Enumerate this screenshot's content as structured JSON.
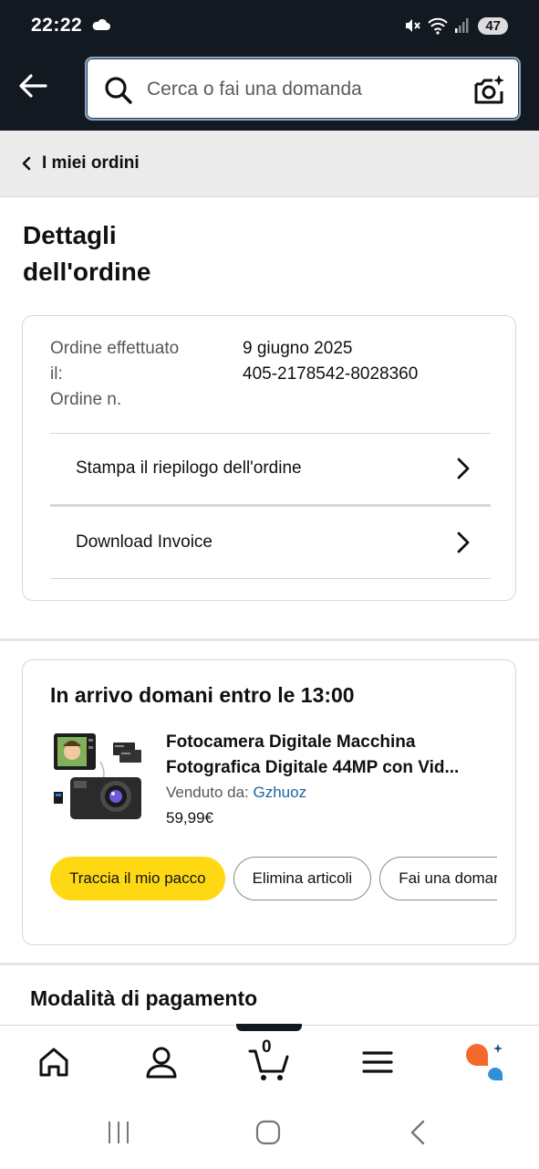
{
  "status_bar": {
    "time": "22:22",
    "battery": "47"
  },
  "header": {
    "search_placeholder": "Cerca o fai una domanda"
  },
  "breadcrumb": {
    "label": "I miei ordini"
  },
  "page": {
    "title_line1": "Dettagli",
    "title_line2": "dell'ordine"
  },
  "order": {
    "placed_label_line1": "Ordine effettuato",
    "placed_label_line2": "il:",
    "number_label": "Ordine n.",
    "placed_date": "9 giugno 2025",
    "number": "405-2178542-8028360",
    "links": [
      {
        "label": "Stampa il riepilogo dell'ordine"
      },
      {
        "label": "Download Invoice"
      }
    ]
  },
  "delivery": {
    "title": "In arrivo domani entro le 13:00",
    "product": {
      "title_line1": "Fotocamera Digitale Macchina",
      "title_line2": "Fotografica Digitale 44MP con Vid...",
      "sold_by_label": "Venduto da: ",
      "seller": "Gzhuoz",
      "price": "59,99€"
    },
    "buttons": [
      {
        "label": "Traccia il mio pacco"
      },
      {
        "label": "Elimina articoli"
      },
      {
        "label": "Fai una domanda"
      }
    ]
  },
  "payment": {
    "title": "Modalità di pagamento"
  },
  "bottom_nav": {
    "items": [
      "home-icon",
      "account-icon",
      "cart-icon",
      "menu-icon",
      "rufus-icon"
    ],
    "cart_count": "0"
  },
  "colors": {
    "header_bg": "#131921",
    "primary_button": "#ffd814",
    "link": "#2162a1",
    "rufus_orange": "#f46a2c",
    "rufus_blue": "#2f8fd8"
  }
}
